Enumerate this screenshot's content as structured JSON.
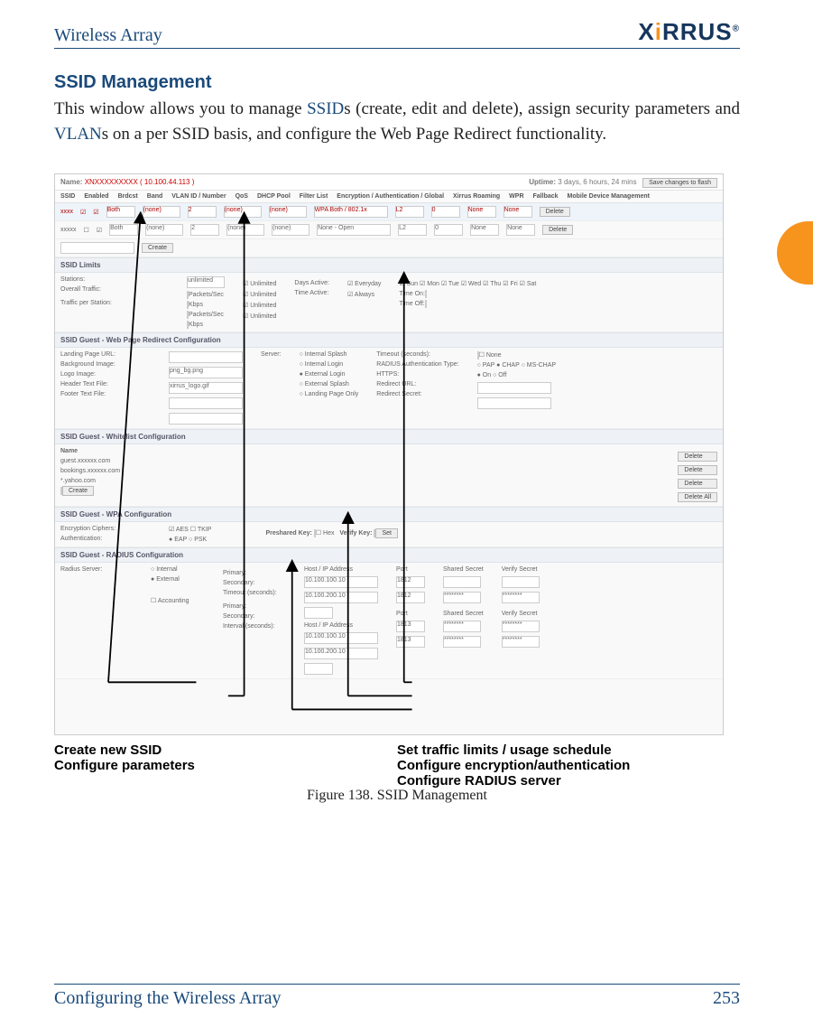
{
  "header": {
    "left": "Wireless Array",
    "logo_text_main": "X",
    "logo_text_dot": "i",
    "logo_text_rest": "RRUS",
    "logo_tm": "®"
  },
  "section": {
    "title": "SSID Management",
    "para_pre": "This window allows you to manage ",
    "para_link1": "SSID",
    "para_mid1": "s (create, edit and delete), assign security parameters and ",
    "para_link2": "VLAN",
    "para_end": "s on a per SSID basis, and configure the Web Page Redirect functionality."
  },
  "screenshot": {
    "topbar": {
      "name_label": "Name:",
      "name_value": "XNXXXXXXXXX   ( 10.100.44.113 )",
      "uptime_label": "Uptime:",
      "uptime_value": "3 days, 6 hours, 24 mins",
      "save_btn": "Save changes to flash"
    },
    "cols": [
      "SSID",
      "Enabled",
      "Brdcst",
      "Band",
      "VLAN ID / Number",
      "QoS",
      "DHCP Pool",
      "Filter List",
      "Encryption / Authentication / Global",
      "Xirrus Roaming",
      "WPR",
      "Fallback",
      "Mobile Device Management"
    ],
    "rows": {
      "row1": {
        "ssid": "xxxx",
        "band": "Both",
        "vlan": "(none)",
        "qos": "2",
        "dhcp": "(none)",
        "filter": "(none)",
        "enc": "WPA Both / 802.1x",
        "roam": "L2",
        "wpr": "0",
        "fallback": "None",
        "mdm": "None",
        "delete": "Delete"
      },
      "row2": {
        "ssid": "xxxxx",
        "band": "Both",
        "vlan": "(none)",
        "qos": "2",
        "dhcp": "(none)",
        "filter": "(none)",
        "enc": "None - Open",
        "roam": "L2",
        "wpr": "0",
        "fallback": "None",
        "mdm": "None",
        "delete": "Delete"
      },
      "create_btn": "Create"
    },
    "sec_limits": {
      "hdr": "SSID Limits",
      "stations": "Stations:",
      "stations_val": "unlimited",
      "overall": "Overall Traffic:",
      "per_sta": "Traffic per Station:",
      "pps": "Packets/Sec",
      "kbps": "Kbps",
      "unlimited": "Unlimited",
      "days_active": "Days Active:",
      "everyday": "Everyday",
      "days": [
        "Sun",
        "Mon",
        "Tue",
        "Wed",
        "Thu",
        "Fri",
        "Sat"
      ],
      "time_active": "Time Active:",
      "always": "Always",
      "time_on": "Time On:",
      "time_off": "Time Off:"
    },
    "sec_wpr": {
      "hdr": "SSID Guest - Web Page Redirect Configuration",
      "landing": "Landing Page URL:",
      "bg": "Background Image:",
      "bg_val": "png_bg.png",
      "logo": "Logo Image:",
      "logo_val": "xirrus_logo.gif",
      "hdr_file": "Header Text File:",
      "ftr_file": "Footer Text File:",
      "server": "Server:",
      "srv_opts": [
        "Internal Splash",
        "Internal Login",
        "External Login",
        "External Splash",
        "Landing Page Only"
      ],
      "timeout": "Timeout (seconds):",
      "none": "None",
      "radius_type": "RADIUS Authentication Type:",
      "radius_opts": [
        "PAP",
        "CHAP",
        "MS-CHAP"
      ],
      "https": "HTTPS:",
      "https_opts": [
        "On",
        "Off"
      ],
      "redirect_url": "Redirect URL:",
      "redirect_secret": "Redirect Secret:"
    },
    "sec_whitelist": {
      "hdr": "SSID Guest - Whitelist Configuration",
      "name": "Name",
      "entries": [
        "guest.xxxxxx.com",
        "bookings.xxxxxx.com",
        "*.yahoo.com"
      ],
      "create": "Create",
      "delete": "Delete",
      "delete_all": "Delete All"
    },
    "sec_wpa": {
      "hdr": "SSID Guest - WPA Configuration",
      "enc_opts": "Encryption Ciphers:",
      "aes": "AES",
      "tkip": "TKIP",
      "auth": "Authentication:",
      "eap": "EAP",
      "psk": "PSK",
      "preshared": "Preshared Key:",
      "hex": "Hex",
      "verify": "Verify Key:",
      "set": "Set"
    },
    "sec_radius": {
      "hdr": "SSID Guest - RADIUS Configuration",
      "server": "Radius Server:",
      "internal": "Internal",
      "external": "External",
      "accounting": "Accounting",
      "primary": "Primary:",
      "secondary": "Secondary:",
      "timeout": "Timeout (seconds):",
      "interval": "Interval (seconds):",
      "host": "Host / IP Address",
      "port": "Port",
      "shared": "Shared Secret",
      "verify": "Verify Secret",
      "ip1": "10.100.100.10",
      "ip2": "10.100.200.10",
      "port1": "1812",
      "port2": "1812",
      "port3": "1813",
      "port4": "1813",
      "dots": "********"
    }
  },
  "labels": {
    "l1": "Create new SSID",
    "l2": "Configure parameters",
    "r1": "Set traffic limits / usage schedule",
    "r2": "Configure encryption/authentication",
    "r3": "Configure RADIUS server"
  },
  "caption": "Figure 138. SSID Management",
  "footer": {
    "left": "Configuring the Wireless Array",
    "right": "253"
  }
}
